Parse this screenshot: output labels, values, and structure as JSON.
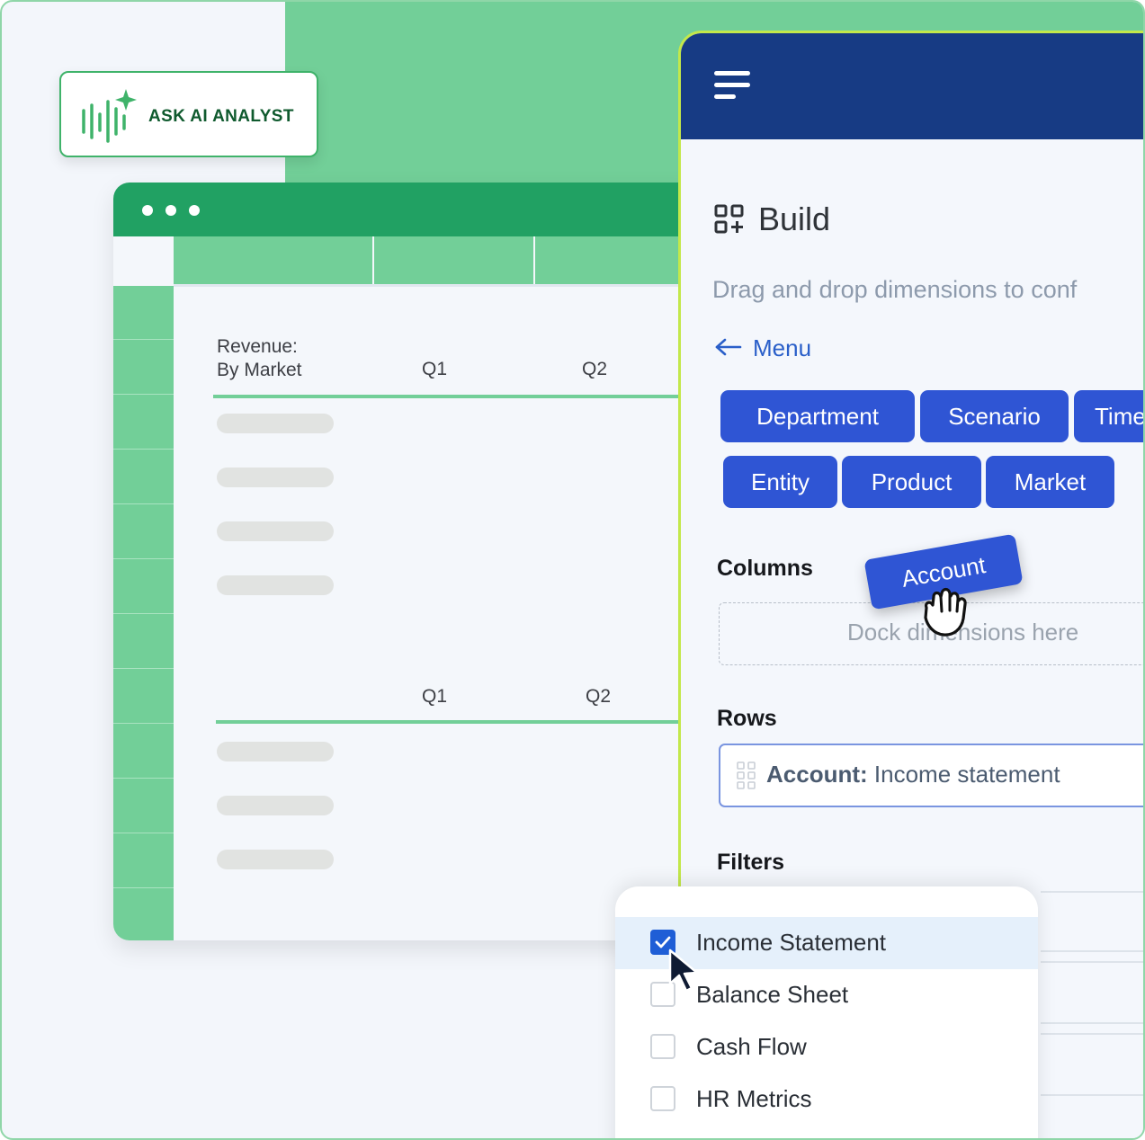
{
  "ai_badge": {
    "label": "ASK AI ANALYST"
  },
  "sheet": {
    "table1": {
      "title_line1": "Revenue:",
      "title_line2": "By Market",
      "col1": "Q1",
      "col2": "Q2"
    },
    "table2": {
      "col1": "Q1",
      "col2": "Q2"
    }
  },
  "build": {
    "title": "Build",
    "subtitle": "Drag and drop dimensions to conf",
    "menu_label": "Menu",
    "chips": [
      "Department",
      "Scenario",
      "Time",
      "Entity",
      "Product",
      "Market"
    ],
    "columns_label": "Columns",
    "dragged_chip": "Account",
    "dock_placeholder": "Dock dimensions here",
    "rows_label": "Rows",
    "rows_value_key": "Account:",
    "rows_value": "Income statement",
    "filters_label": "Filters"
  },
  "filter_dropdown": {
    "items": [
      {
        "label": "Income Statement",
        "checked": true
      },
      {
        "label": "Balance Sheet",
        "checked": false
      },
      {
        "label": "Cash Flow",
        "checked": false
      },
      {
        "label": "HR Metrics",
        "checked": false
      }
    ]
  },
  "colors": {
    "green_primary": "#21a163",
    "green_light": "#72cf98",
    "navy_header": "#173b84",
    "chip_blue": "#2f55d4",
    "accent_lime": "#c3e84a"
  }
}
